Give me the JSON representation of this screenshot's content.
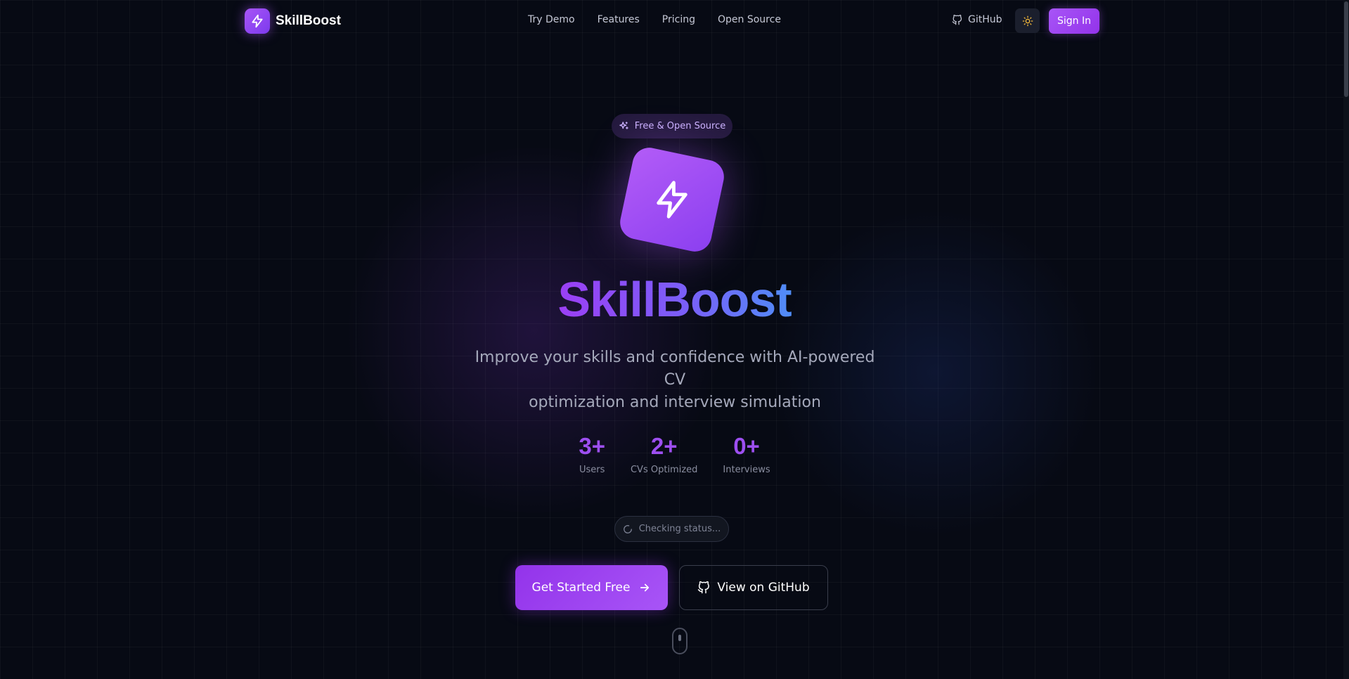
{
  "brand": {
    "name": "SkillBoost"
  },
  "nav": {
    "items": [
      "Try Demo",
      "Features",
      "Pricing",
      "Open Source"
    ]
  },
  "header": {
    "github_label": "GitHub",
    "signin_label": "Sign In"
  },
  "hero": {
    "badge": "Free & Open Source",
    "title": "SkillBoost",
    "subtitle_line1": "Improve your skills and confidence with AI-powered CV",
    "subtitle_line2": "optimization and interview simulation",
    "stats": [
      {
        "value": "3+",
        "label": "Users"
      },
      {
        "value": "2+",
        "label": "CVs Optimized"
      },
      {
        "value": "0+",
        "label": "Interviews"
      }
    ],
    "status_text": "Checking status...",
    "primary_cta": "Get Started Free",
    "secondary_cta": "View on GitHub"
  },
  "colors": {
    "accent": "#a855f7",
    "accent_dark": "#9333ea",
    "gradient_blue": "#4f8df7",
    "background": "#070a14"
  },
  "icons": {
    "logo": "lightning-bolt-icon",
    "badge": "sparkles-icon",
    "hero": "lightning-bolt-icon",
    "github": "github-icon",
    "theme": "sun-icon",
    "status": "loading-spinner-icon",
    "cta_arrow": "arrow-right-icon",
    "scroll": "mouse-scroll-icon"
  }
}
